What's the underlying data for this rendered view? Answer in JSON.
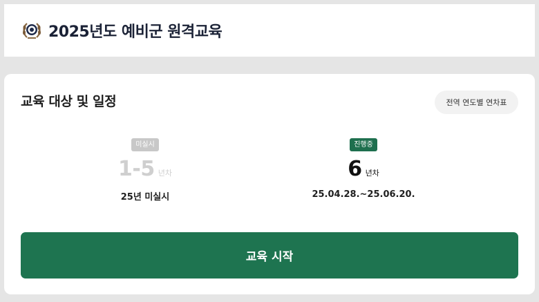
{
  "header": {
    "emblem_icon": "military-emblem-icon",
    "title": "2025년도 예비군 원격교육"
  },
  "schedule": {
    "title": "교육 대상 및 일정",
    "chart_button_label": "전역 연도별 연차표",
    "rounds": [
      {
        "badge": "미실시",
        "number": "1-5",
        "unit": "년차",
        "detail": "25년 미실시"
      },
      {
        "badge": "진행중",
        "number": "6",
        "unit": "년차",
        "detail": "25.04.28.~25.06.20."
      }
    ]
  },
  "start_button_label": "교육 시작",
  "colors": {
    "primary_green": "#1e7450",
    "badge_grey": "#c8c8c8",
    "badge_green": "#1e6f4e"
  }
}
